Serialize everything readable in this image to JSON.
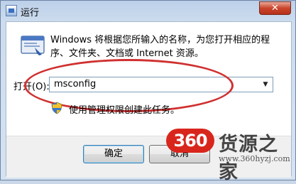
{
  "window": {
    "title": "运行",
    "close_glyph": "✕"
  },
  "dialog": {
    "description": "Windows 将根据您所输入的名称，为您打开相应的程序、文件夹、文档或 Internet 资源。",
    "open_label": "打开(O):",
    "open_value": "msconfig",
    "admin_note": "使用管理权限创建此任务。"
  },
  "buttons": {
    "ok": "确定",
    "cancel": "取消"
  },
  "watermark": {
    "badge": "360",
    "text": "货源之家",
    "url": "www.360hyzj.com"
  },
  "colors": {
    "highlight_oval": "#d03030",
    "badge": "#d9261c"
  }
}
